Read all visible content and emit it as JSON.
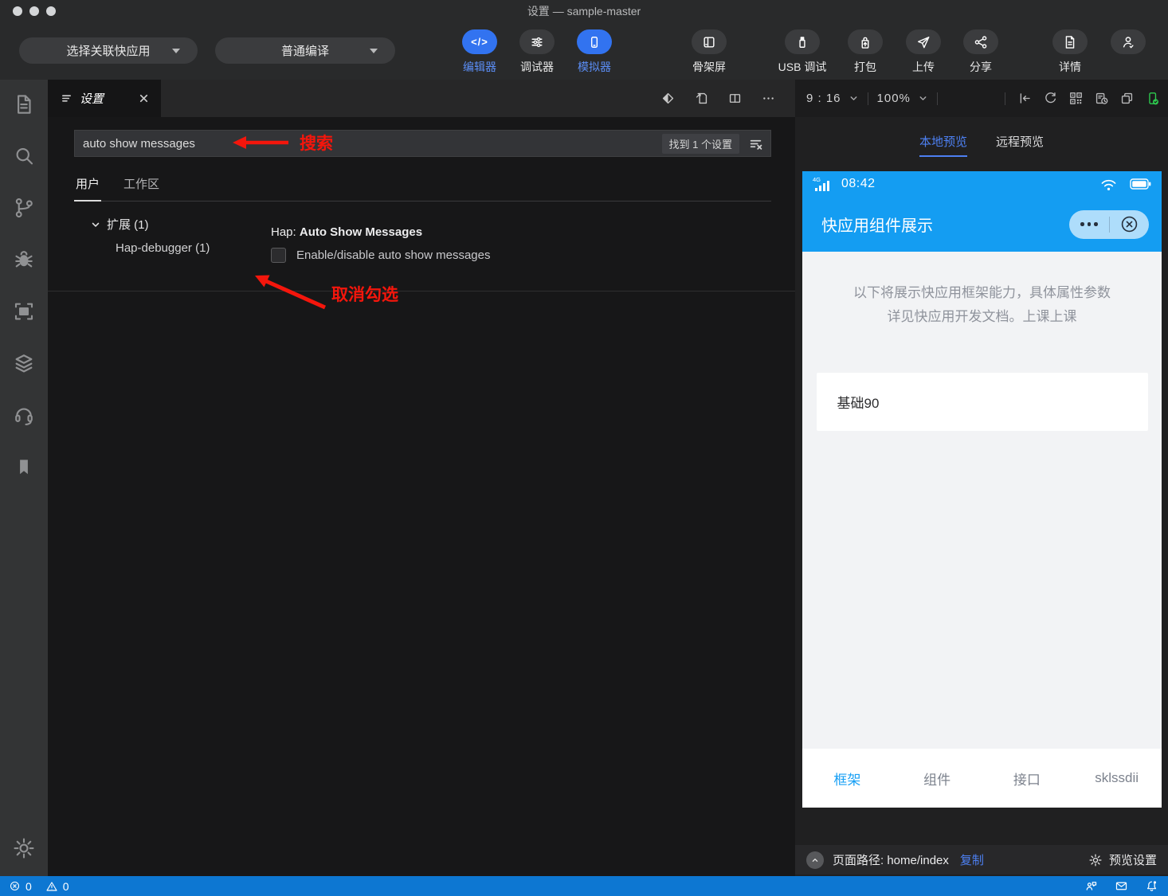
{
  "titlebar": {
    "title": "设置 — sample-master"
  },
  "toolbar": {
    "app_dropdown": "选择关联快应用",
    "build_dropdown": "普通编译",
    "editor": "编辑器",
    "debugger": "调试器",
    "simulator": "模拟器",
    "skeleton": "骨架屏",
    "usb_debug": "USB 调试",
    "package": "打包",
    "upload": "上传",
    "share": "分享",
    "details": "详情"
  },
  "editor": {
    "tab_title": "设置",
    "search_value": "auto show messages",
    "results_count": "找到 1 个设置",
    "scope_tabs": {
      "user": "用户",
      "workspace": "工作区"
    },
    "tree": {
      "group": "扩展 (1)",
      "item": "Hap-debugger (1)"
    },
    "setting": {
      "title_prefix": "Hap: ",
      "title_bold": "Auto Show Messages",
      "description": "Enable/disable auto show messages"
    },
    "annotations": {
      "search": "搜索",
      "uncheck": "取消勾选"
    }
  },
  "panel": {
    "ratio": "9 : 16",
    "zoom": "100%",
    "tabs": {
      "local": "本地预览",
      "remote": "远程预览"
    },
    "footer": {
      "path_label": "页面路径: home/index",
      "copy": "复制",
      "settings": "预览设置"
    }
  },
  "phone": {
    "network": "4G",
    "time": "08:42",
    "app_title": "快应用组件展示",
    "intro_line1": "以下将展示快应用框架能力，具体属性参数",
    "intro_line2": "详见快应用开发文档。上课上课",
    "card": "基础90",
    "nav": [
      "框架",
      "组件",
      "接口",
      "sklssdii"
    ]
  },
  "statusbar": {
    "errors": "0",
    "warnings": "0"
  },
  "colors": {
    "accent_blue": "#3273f0",
    "phone_blue": "#149df2",
    "status_blue": "#0d77d2",
    "annotation_red": "#f4160c",
    "link_blue": "#4d80f2",
    "green": "#2ecc4f"
  }
}
